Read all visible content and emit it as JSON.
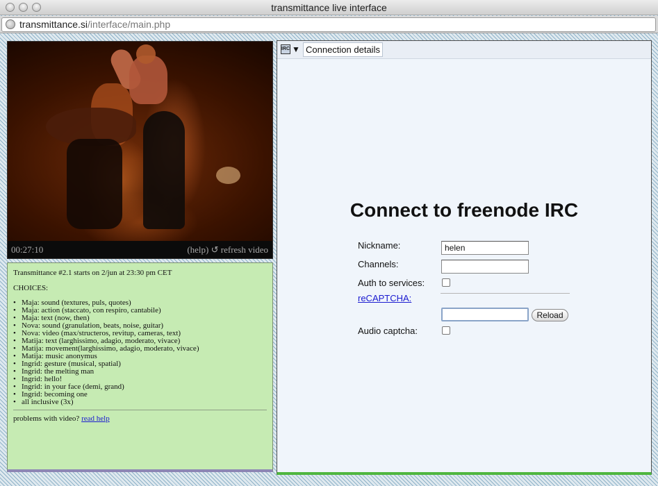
{
  "window": {
    "title": "transmittance live interface"
  },
  "urlbar": {
    "host": "transmittance.si",
    "path": "/interface/main.php"
  },
  "video": {
    "timecode": "00:27:10",
    "help_label": "(help)",
    "refresh_label": "↺ refresh video"
  },
  "info": {
    "intro": "Transmittance #2.1 starts on 2/jun at 23:30 pm CET",
    "choices_heading": "CHOICES:",
    "bullet": "•",
    "choices": [
      "Maja: sound (textures, puls, quotes)",
      "Maja: action (staccato, con respiro, cantabile)",
      "Maja: text (now, then)",
      "Nova: sound (granulation, beats, noise, guitar)",
      "Nova: video (max/structeros, revitup, cameras, text)",
      "Matija: text (larghissimo, adagio, moderato, vivace)",
      "Matija: movement(larghissimo, adagio, moderato, vivace)",
      "Matija: music anonymus",
      "Ingrid: gesture (musical, spatial)",
      "Ingrid: the melting man",
      "Ingrid: hello!",
      "Ingrid: in your face (demi, grand)",
      "Ingrid: becoming one",
      "all inclusive (3x)"
    ],
    "help_text": "problems with video?",
    "help_link": "read help"
  },
  "irc": {
    "icon_text": "IRC",
    "dropdown_glyph": "▼",
    "tab_label": "Connection details",
    "connect_title": "Connect to freenode IRC",
    "nickname_label": "Nickname:",
    "nickname_value": "helen",
    "channels_label": "Channels:",
    "channels_value": "",
    "auth_label": "Auth to services:",
    "captcha_link": "reCAPTCHA:",
    "reload_label": "Reload",
    "audio_captcha_label": "Audio captcha:"
  }
}
